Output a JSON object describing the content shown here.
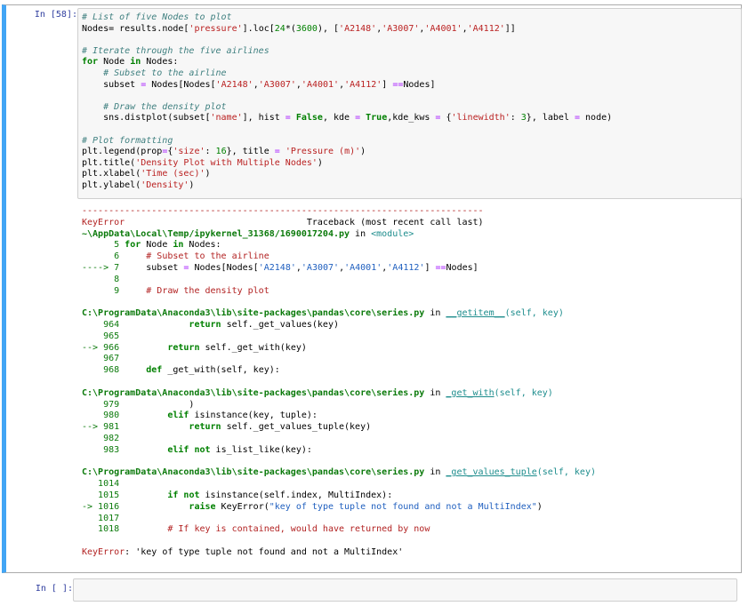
{
  "cell1": {
    "prompt": "In [58]:",
    "code": {
      "l1": "# List of five Nodes to plot",
      "l2a": "Nodes",
      "l2b": "= results.node[",
      "l2c": "'pressure'",
      "l2d": "].loc[",
      "l2e": "24",
      "l2f": "*(",
      "l2g": "3600",
      "l2h": "), [",
      "l2i": "'A2148'",
      "l2j": ",",
      "l2k": "'A3007'",
      "l2l": ",",
      "l2m": "'A4001'",
      "l2n": ",",
      "l2o": "'A4112'",
      "l2p": "]]",
      "l4": "# Iterate through the five airlines",
      "l5a": "for",
      "l5b": " Node ",
      "l5c": "in",
      "l5d": " Nodes:",
      "l6": "    # Subset to the airline",
      "l7a": "    subset ",
      "l7b": "=",
      "l7c": " Nodes[Nodes[",
      "l7d": "'A2148'",
      "l7e": ",",
      "l7f": "'A3007'",
      "l7g": ",",
      "l7h": "'A4001'",
      "l7i": ",",
      "l7j": "'A4112'",
      "l7k": "] ",
      "l7l": "==",
      "l7m": "Nodes]",
      "l9": "    # Draw the density plot",
      "l10a": "    sns.distplot(subset[",
      "l10b": "'name'",
      "l10c": "], hist ",
      "l10d": "=",
      "l10e": " False",
      "l10f": ", kde ",
      "l10g": "=",
      "l10h": " True",
      "l10i": ",kde_kws ",
      "l10j": "=",
      "l10k": " {",
      "l10l": "'linewidth'",
      "l10m": ": ",
      "l10n": "3",
      "l10o": "}, label ",
      "l10p": "=",
      "l10q": " node)",
      "l12": "# Plot formatting",
      "l13a": "plt.legend(prop",
      "l13b": "=",
      "l13c": "{",
      "l13d": "'size'",
      "l13e": ": ",
      "l13f": "16",
      "l13g": "}, title ",
      "l13h": "=",
      "l13i": " ",
      "l13j": "'Pressure (m)'",
      "l13k": ")",
      "l14a": "plt.title(",
      "l14b": "'Density Plot with Multiple Nodes'",
      "l14c": ")",
      "l15a": "plt.xlabel(",
      "l15b": "'Time (sec)'",
      "l15c": ")",
      "l16a": "plt.ylabel(",
      "l16b": "'Density'",
      "l16c": ")"
    },
    "output": {
      "dashes": "---------------------------------------------------------------------------",
      "err_name": "KeyError",
      "traceback_hdr": "                                  Traceback (most recent call last)",
      "file1": "~\\AppData\\Local\\Temp/ipykernel_31368/1690017204.py",
      "file1_in": " in ",
      "file1_mod": "<module>",
      "f1l5n": "      5 ",
      "f1l5a": "for",
      "f1l5b": " Node ",
      "f1l5c": "in",
      "f1l5d": " Nodes:",
      "f1l6n": "      6 ",
      "f1l6": "    # Subset to the airline",
      "f1l7n": "----> 7 ",
      "f1l7a": "    subset ",
      "f1l7b": "=",
      "f1l7c": " Nodes[Nodes[",
      "f1l7d": "'A2148'",
      "f1l7e": ",",
      "f1l7f": "'A3007'",
      "f1l7g": ",",
      "f1l7h": "'A4001'",
      "f1l7i": ",",
      "f1l7j": "'A4112'",
      "f1l7k": "] ",
      "f1l7l": "==",
      "f1l7m": "Nodes]",
      "f1l8n": "      8",
      "f1l9n": "      9 ",
      "f1l9": "    # Draw the density plot",
      "file2": "C:\\ProgramData\\Anaconda3\\lib\\site-packages\\pandas\\core\\series.py",
      "file2_in": " in ",
      "file2_fn": "__getitem__",
      "file2_args": "(self, key)",
      "f2l964n": "    964 ",
      "f2l964a": "            ",
      "f2l964b": "return",
      "f2l964c": " self._get_values(key)",
      "f2l965n": "    965",
      "f2l966n": "--> 966 ",
      "f2l966a": "        ",
      "f2l966b": "return",
      "f2l966c": " self._get_with(key)",
      "f2l967n": "    967",
      "f2l968n": "    968 ",
      "f2l968a": "    ",
      "f2l968b": "def",
      "f2l968c": " _get_with(self, key):",
      "file3": "C:\\ProgramData\\Anaconda3\\lib\\site-packages\\pandas\\core\\series.py",
      "file3_in": " in ",
      "file3_fn": "_get_with",
      "file3_args": "(self, key)",
      "f3l979n": "    979 ",
      "f3l979": "            )",
      "f3l980n": "    980 ",
      "f3l980a": "        ",
      "f3l980b": "elif",
      "f3l980c": " isinstance(key, tuple):",
      "f3l981n": "--> 981 ",
      "f3l981a": "            ",
      "f3l981b": "return",
      "f3l981c": " self._get_values_tuple(key)",
      "f3l982n": "    982",
      "f3l983n": "    983 ",
      "f3l983a": "        ",
      "f3l983b": "elif",
      "f3l983c": " ",
      "f3l983d": "not",
      "f3l983e": " is_list_like(key):",
      "file4": "C:\\ProgramData\\Anaconda3\\lib\\site-packages\\pandas\\core\\series.py",
      "file4_in": " in ",
      "file4_fn": "_get_values_tuple",
      "file4_args": "(self, key)",
      "f4l1014n": "   1014",
      "f4l1015n": "   1015 ",
      "f4l1015a": "        ",
      "f4l1015b": "if",
      "f4l1015c": " ",
      "f4l1015d": "not",
      "f4l1015e": " isinstance(self.index, MultiIndex):",
      "f4l1016n": "-> 1016 ",
      "f4l1016a": "            ",
      "f4l1016b": "raise",
      "f4l1016c": " KeyError(",
      "f4l1016d": "\"key of type tuple not found and not a MultiIndex\"",
      "f4l1016e": ")",
      "f4l1017n": "   1017",
      "f4l1018n": "   1018 ",
      "f4l1018": "        # If key is contained, would have returned by now",
      "final_err": "KeyError",
      "final_msg": ": 'key of type tuple not found and not a MultiIndex'"
    }
  },
  "cell2": {
    "prompt": "In [ ]:"
  }
}
